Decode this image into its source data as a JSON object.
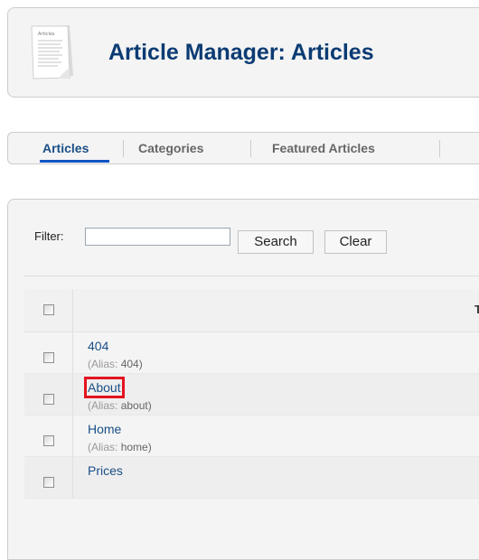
{
  "header": {
    "title": "Article Manager: Articles",
    "icon": "article-manager-icon",
    "icon_caption": "Articles"
  },
  "subnav": {
    "items": [
      {
        "label": "Articles",
        "active": true
      },
      {
        "label": "Categories",
        "active": false
      },
      {
        "label": "Featured Articles",
        "active": false
      }
    ]
  },
  "filter": {
    "label": "Filter:",
    "value": "",
    "placeholder": "",
    "search_label": "Search",
    "clear_label": "Clear"
  },
  "table": {
    "title_header": "Ti",
    "rows": [
      {
        "title": "404",
        "alias_label": "(Alias:",
        "alias": "404)",
        "highlighted": false
      },
      {
        "title": "About",
        "alias_label": "(Alias:",
        "alias": "about)",
        "highlighted": true
      },
      {
        "title": "Home",
        "alias_label": "(Alias:",
        "alias": "home)",
        "highlighted": false
      },
      {
        "title": "Prices",
        "alias_label": "",
        "alias": "",
        "highlighted": false
      }
    ]
  },
  "colors": {
    "title": "#0b3b73",
    "link": "#1a4f86",
    "active_tab_underline": "#0b55c4",
    "highlight_box": "#e3131f",
    "row_alt": "#eeeeee"
  }
}
